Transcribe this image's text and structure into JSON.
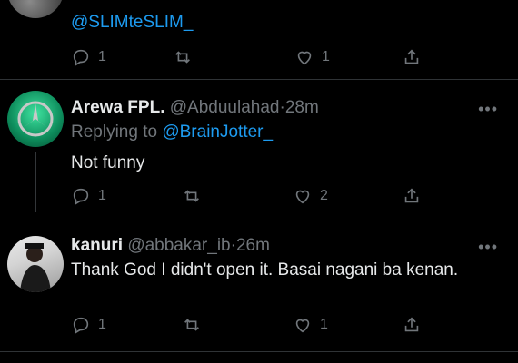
{
  "top_tweet": {
    "mention": "@SLIMteSLIM_",
    "reply_count": "1",
    "like_count": "1"
  },
  "tweet1": {
    "name": "Arewa FPL.",
    "handle": "@Abduulahad",
    "separator": "·",
    "time": "28m",
    "replying_prefix": "Replying to",
    "replying_to": "@BrainJotter_",
    "text": "Not funny",
    "reply_count": "1",
    "like_count": "2",
    "more": "•••"
  },
  "tweet2": {
    "name": "kanuri",
    "handle": "@abbakar_ib",
    "separator": "·",
    "time": "26m",
    "text": "Thank God I didn't open it. Basai nagani ba kenan.",
    "reply_count": "1",
    "like_count": "1",
    "more": "•••"
  },
  "colors": {
    "background": "#000000",
    "text": "#e7e9ea",
    "muted": "#71767b",
    "link": "#1d9bf0",
    "divider": "#2f3336"
  }
}
